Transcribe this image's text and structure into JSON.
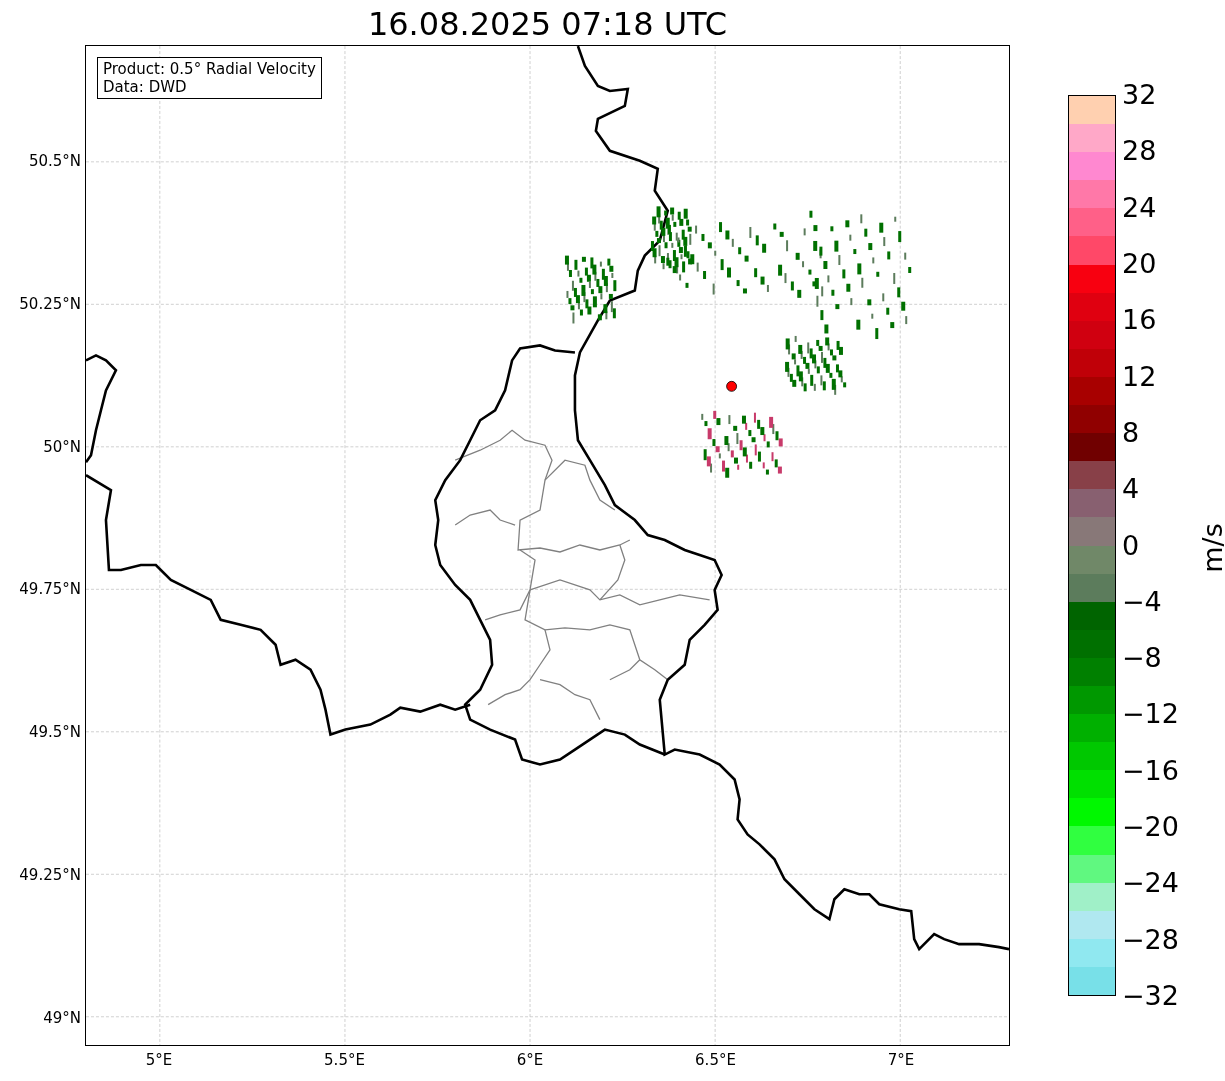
{
  "title": "16.08.2025 07:18 UTC",
  "info_box": [
    "Product: 0.5° Radial Velocity",
    "Data: DWD"
  ],
  "y_ticks": [
    "50.5°N",
    "50.25°N",
    "50°N",
    "49.75°N",
    "49.5°N",
    "49.25°N",
    "49°N"
  ],
  "x_ticks": [
    "5°E",
    "5.5°E",
    "6°E",
    "6.5°E",
    "7°E"
  ],
  "colorbar": {
    "label": "m/s",
    "ticks": [
      "32",
      "28",
      "24",
      "20",
      "16",
      "12",
      "8",
      "4",
      "0",
      "−4",
      "−8",
      "−12",
      "−16",
      "−20",
      "−24",
      "−28",
      "−32"
    ],
    "segments": [
      {
        "color": "#ffd0b0"
      },
      {
        "color": "#ffa8c8"
      },
      {
        "color": "#ff88d0"
      },
      {
        "color": "#ff78a8"
      },
      {
        "color": "#ff6088"
      },
      {
        "color": "#ff4868"
      },
      {
        "color": "#f80010"
      },
      {
        "color": "#e00010"
      },
      {
        "color": "#d00010"
      },
      {
        "color": "#c00008"
      },
      {
        "color": "#a80000"
      },
      {
        "color": "#900000"
      },
      {
        "color": "#700000"
      },
      {
        "color": "#884048"
      },
      {
        "color": "#886070"
      },
      {
        "color": "#887878"
      },
      {
        "color": "#708868"
      },
      {
        "color": "#5c7c5c"
      },
      {
        "color": "#006400"
      },
      {
        "color": "#007000"
      },
      {
        "color": "#008000"
      },
      {
        "color": "#009800"
      },
      {
        "color": "#00b000"
      },
      {
        "color": "#00c800"
      },
      {
        "color": "#00e000"
      },
      {
        "color": "#00f800"
      },
      {
        "color": "#30ff40"
      },
      {
        "color": "#60f880"
      },
      {
        "color": "#a0f0c8"
      },
      {
        "color": "#b0e8f0"
      },
      {
        "color": "#90e8f0"
      },
      {
        "color": "#78e0e8"
      }
    ]
  }
}
